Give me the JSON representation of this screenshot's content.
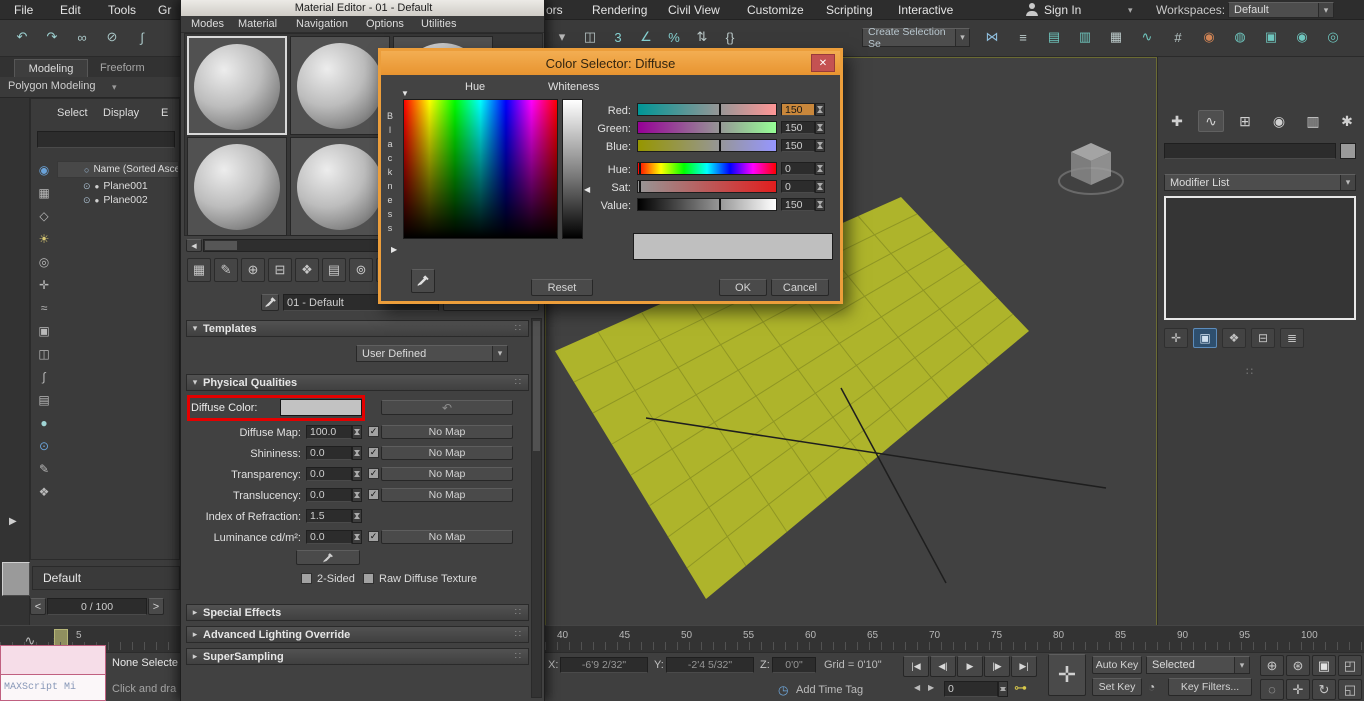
{
  "glyphs": {
    "caret": "▾",
    "caret_left": "◀",
    "caret_right": "▶",
    "check": "✓",
    "expanded": "▾",
    "collapsed": "▸",
    "grip": "∷",
    "close": "✕",
    "scroll_left": "◀",
    "prev_btn": "<",
    "next_btn": ">",
    "panel_expand": "▶",
    "tri_down": "▼",
    "tri_right": "▶",
    "tri_left": "◀",
    "circle": "○",
    "eye": "⊙",
    "dot": "●",
    "undo_arrow": "↶",
    "key": "⊶",
    "keymode": "◔",
    "time_tag_clock": "◷",
    "ellipsis": "⋯"
  },
  "menu_bar": {
    "file": "File",
    "edit": "Edit",
    "tools": "Tools",
    "group_partial": "Gr",
    "editors_partial": "ors",
    "rendering": "Rendering",
    "civil_view": "Civil View",
    "customize": "Customize",
    "scripting": "Scripting",
    "interactive": "Interactive",
    "sign_in": "Sign In",
    "workspaces_label": "Workspaces:",
    "workspaces_value": "Default"
  },
  "main_toolbar": {
    "selection_combo": "Create Selection Se",
    "left_icons": [
      {
        "name": "undo-icon",
        "glyph": "↶",
        "color": "#9fd4d4"
      },
      {
        "name": "redo-icon",
        "glyph": "↷",
        "color": "#9fd4d4"
      },
      {
        "name": "select-and-link-icon",
        "glyph": "∞",
        "color": "#a9c6c6"
      },
      {
        "name": "unlink-selection-icon",
        "glyph": "⊘",
        "color": "#a9c6c6"
      },
      {
        "name": "bind-to-space-warp-icon",
        "glyph": "∫",
        "color": "#a9c6c6"
      }
    ],
    "mid_icons": [
      {
        "name": "toolbar-overflow-icon",
        "glyph": "▾",
        "color": "#b5b5b5"
      },
      {
        "name": "window-crossing-icon",
        "glyph": "◫",
        "color": "#bccaca"
      },
      {
        "name": "snaps-toggle-icon",
        "glyph": "3",
        "color": "#86d2d2"
      },
      {
        "name": "angle-snap-icon",
        "glyph": "∠",
        "color": "#86d2d2"
      },
      {
        "name": "percent-snap-icon",
        "glyph": "%",
        "color": "#86d2d2"
      },
      {
        "name": "spinner-snap-icon",
        "glyph": "⇅",
        "color": "#bccaca"
      },
      {
        "name": "named-selection-sets-icon",
        "glyph": "{}",
        "color": "#bccaca"
      }
    ],
    "right_icons": [
      {
        "name": "mirror-icon",
        "glyph": "⋈",
        "color": "#8fbede"
      },
      {
        "name": "align-icon",
        "glyph": "≡",
        "color": "#bccaca"
      },
      {
        "name": "toggle-scene-explorer-icon",
        "glyph": "▤",
        "color": "#6fc6be"
      },
      {
        "name": "toggle-layer-explorer-icon",
        "glyph": "▥",
        "color": "#6fc6be"
      },
      {
        "name": "toggle-ribbon-icon",
        "glyph": "▦",
        "color": "#bccaca"
      },
      {
        "name": "curve-editor-icon",
        "glyph": "∿",
        "color": "#6fc6be"
      },
      {
        "name": "schematic-view-icon",
        "glyph": "#",
        "color": "#bccaca"
      },
      {
        "name": "material-editor-icon",
        "glyph": "◉",
        "color": "#d08455"
      },
      {
        "name": "render-setup-icon",
        "glyph": "◍",
        "color": "#6fc6be"
      },
      {
        "name": "rendered-frame-window-icon",
        "glyph": "▣",
        "color": "#6fc6be"
      },
      {
        "name": "render-production-icon",
        "glyph": "◉",
        "color": "#6fc6be"
      },
      {
        "name": "render-iterative-icon",
        "glyph": "◎",
        "color": "#6fc6be"
      }
    ]
  },
  "ribbon": {
    "tab_modeling": "Modeling",
    "tab_freeform": "Freeform",
    "polygon_modeling": "Polygon Modeling"
  },
  "scene_explorer": {
    "menu_select": "Select",
    "menu_display": "Display",
    "menu_edit_partial": "E",
    "search_value": "",
    "header": "Name (Sorted Ascend",
    "rows": [
      {
        "name": "Plane001"
      },
      {
        "name": "Plane002"
      }
    ],
    "filter_icons": [
      {
        "name": "filter-selection-icon",
        "glyph": "◉",
        "color": "#6aa2d8"
      },
      {
        "name": "filter-geometry-icon",
        "glyph": "▦",
        "color": "#b9b9b9"
      },
      {
        "name": "filter-shapes-icon",
        "glyph": "◇",
        "color": "#b9b9b9"
      },
      {
        "name": "filter-lights-icon",
        "glyph": "☀",
        "color": "#d8c873"
      },
      {
        "name": "filter-cameras-icon",
        "glyph": "◎",
        "color": "#b9b9b9"
      },
      {
        "name": "filter-helpers-icon",
        "glyph": "✛",
        "color": "#b9b9b9"
      },
      {
        "name": "filter-spacewarps-icon",
        "glyph": "≈",
        "color": "#b9b9b9"
      },
      {
        "name": "filter-groups-icon",
        "glyph": "▣",
        "color": "#b9b9b9"
      },
      {
        "name": "filter-xrefs-icon",
        "glyph": "◫",
        "color": "#b9b9b9"
      },
      {
        "name": "filter-bones-icon",
        "glyph": "∫",
        "color": "#b9b9b9"
      },
      {
        "name": "filter-containers-icon",
        "glyph": "▤",
        "color": "#b9b9b9"
      },
      {
        "name": "filter-materials-icon",
        "glyph": "●",
        "color": "#9fd4d4"
      },
      {
        "name": "sync-selection-icon",
        "glyph": "⊙",
        "color": "#6aa2d8"
      },
      {
        "name": "pick-object-icon",
        "glyph": "✎",
        "color": "#b9b9b9"
      },
      {
        "name": "explorer-settings-icon",
        "glyph": "❖",
        "color": "#b9b9b9"
      }
    ]
  },
  "left_strip": {
    "default_layer": "Default",
    "frame_counter": "0 / 100"
  },
  "material_editor": {
    "title": "Material Editor - 01 - Default",
    "menus": {
      "modes": "Modes",
      "material": "Material",
      "navigation": "Navigation",
      "options": "Options",
      "utilities": "Utilities"
    },
    "material_name": "01 - Default",
    "toolbar_icons": [
      {
        "name": "sample-windows-icon",
        "glyph": "▦",
        "color": "#c6c6c6"
      },
      {
        "name": "pick-material-icon",
        "glyph": "✎",
        "color": "#c6c6c6"
      },
      {
        "name": "assign-material-icon",
        "glyph": "⊕",
        "color": "#c6c6c6"
      },
      {
        "name": "delete-material-icon",
        "glyph": "⊟",
        "color": "#c6c6c6"
      },
      {
        "name": "make-unique-icon",
        "glyph": "❖",
        "color": "#c6c6c6"
      },
      {
        "name": "put-to-library-icon",
        "glyph": "▤",
        "color": "#c6c6c6"
      },
      {
        "name": "material-id-icon",
        "glyph": "⊚",
        "color": "#c6c6c6"
      },
      {
        "name": "show-map-icon",
        "glyph": "◐",
        "color": "#c6c6c6"
      }
    ],
    "templates": {
      "header": "Templates",
      "value": "User Defined"
    },
    "physical": {
      "header": "Physical Qualities",
      "diffuse_color_label": "Diffuse Color:",
      "diffuse_color_hex": "#c2c2c2",
      "rows": [
        {
          "label": "Diffuse Map:",
          "value": "100.0",
          "map": "No Map"
        },
        {
          "label": "Shininess:",
          "value": "0.0",
          "map": "No Map"
        },
        {
          "label": "Transparency:",
          "value": "0.0",
          "map": "No Map"
        },
        {
          "label": "Translucency:",
          "value": "0.0",
          "map": "No Map"
        },
        {
          "label": "Index of Refraction:",
          "value": "1.5"
        },
        {
          "label": "Luminance cd/m²:",
          "value": "0.0",
          "map": "No Map"
        }
      ],
      "two_sided": "2-Sided",
      "raw_diffuse": "Raw Diffuse Texture"
    },
    "sections": {
      "special_effects": "Special Effects",
      "advanced_lighting": "Advanced Lighting Override",
      "supersampling": "SuperSampling"
    }
  },
  "color_selector": {
    "title": "Color Selector: Diffuse",
    "hue_label": "Hue",
    "whiteness_label": "Whiteness",
    "blackness_label": "Blackness",
    "current_color_hex": "#bfbfbf",
    "channels": [
      {
        "label": "Red:",
        "value": "150"
      },
      {
        "label": "Green:",
        "value": "150"
      },
      {
        "label": "Blue:",
        "value": "150"
      },
      {
        "label": "Hue:",
        "value": "0"
      },
      {
        "label": "Sat:",
        "value": "0"
      },
      {
        "label": "Value:",
        "value": "150"
      }
    ],
    "reset": "Reset",
    "ok": "OK",
    "cancel": "Cancel"
  },
  "viewport": {
    "plane_color": "#aeb42b"
  },
  "command_panel": {
    "modifier_list": "Modifier List",
    "tabs": [
      {
        "name": "create-tab-icon",
        "glyph": "✚",
        "color": "#d0d0d0"
      },
      {
        "name": "modify-tab-icon",
        "glyph": "∿",
        "color": "#d0d0d0",
        "cls": "tab-active"
      },
      {
        "name": "hierarchy-tab-icon",
        "glyph": "⊞",
        "color": "#d0d0d0"
      },
      {
        "name": "motion-tab-icon",
        "glyph": "◉",
        "color": "#d0d0d0"
      },
      {
        "name": "display-tab-icon",
        "glyph": "▥",
        "color": "#d0d0d0"
      },
      {
        "name": "utilities-tab-icon",
        "glyph": "✱",
        "color": "#d0d0d0"
      }
    ],
    "stack_icons": [
      {
        "name": "pin-stack-icon",
        "glyph": "✛",
        "color": "#c2c2c2"
      },
      {
        "name": "show-end-result-icon",
        "glyph": "▣",
        "color": "#cfe0f0",
        "cls": "hl-icon"
      },
      {
        "name": "make-unique-icon",
        "glyph": "❖",
        "color": "#c2c2c2"
      },
      {
        "name": "remove-modifier-icon",
        "glyph": "⊟",
        "color": "#c2c2c2"
      },
      {
        "name": "configure-modifier-sets-icon",
        "glyph": "≣",
        "color": "#c2c2c2"
      }
    ]
  },
  "timeline": {
    "left_tick": "5",
    "ticks": [
      "40",
      "45",
      "50",
      "55",
      "60",
      "65",
      "70",
      "75",
      "80",
      "85",
      "90",
      "95",
      "100"
    ],
    "trackbar_icons": [
      {
        "name": "open-mini-curve-editor-icon",
        "glyph": "∿",
        "color": "#b9b9b9"
      },
      {
        "name": "trackbar-keys-icon",
        "glyph": "≋",
        "color": "#b9b9b9"
      }
    ]
  },
  "status_bar": {
    "maxscript_label": "MAXScript Mi",
    "none_selected": "None Selecte",
    "click_drag": "Click and dra",
    "x_label": "X:",
    "x_value": "-6'9 2/32\"",
    "y_label": "Y:",
    "y_value": "-2'4 5/32\"",
    "z_label": "Z:",
    "z_value": "0'0\"",
    "grid_label": "Grid = 0'10\"",
    "add_time_tag": "Add Time Tag",
    "frame_value": "0",
    "auto_key": "Auto Key",
    "set_key": "Set Key",
    "selected_combo": "Selected",
    "key_filters": "Key Filters...",
    "transport": [
      {
        "name": "go-to-start-button",
        "glyph": "|◀",
        "color": "#d8d8d8",
        "cls": "tbtn"
      },
      {
        "name": "previous-frame-button",
        "glyph": "◀|",
        "color": "#d8d8d8",
        "cls": "tbtn"
      },
      {
        "name": "play-button",
        "glyph": "▶",
        "color": "#d8d8d8",
        "cls": "tbtn"
      },
      {
        "name": "next-frame-button",
        "glyph": "|▶",
        "color": "#d8d8d8",
        "cls": "tbtn"
      },
      {
        "name": "go-to-end-button",
        "glyph": "▶|",
        "color": "#d8d8d8",
        "cls": "tbtn"
      }
    ],
    "nav_icons_row1": [
      {
        "name": "zoom-icon",
        "glyph": "⊕",
        "color": "#c6c6c6"
      },
      {
        "name": "zoom-all-icon",
        "glyph": "⊛",
        "color": "#c6c6c6"
      },
      {
        "name": "zoom-extents-icon",
        "glyph": "▣",
        "color": "#e2e2e2"
      },
      {
        "name": "zoom-extents-all-icon",
        "glyph": "◰",
        "color": "#c6c6c6"
      }
    ],
    "nav_icons_row2": [
      {
        "name": "zoom-region-icon",
        "glyph": "◌",
        "color": "#c6c6c6"
      },
      {
        "name": "pan-icon",
        "glyph": "✛",
        "color": "#c6c6c6"
      },
      {
        "name": "orbit-icon",
        "glyph": "↻",
        "color": "#c6c6c6"
      },
      {
        "name": "maximize-viewport-toggle-icon",
        "glyph": "◱",
        "color": "#c6c6c6"
      }
    ]
  }
}
